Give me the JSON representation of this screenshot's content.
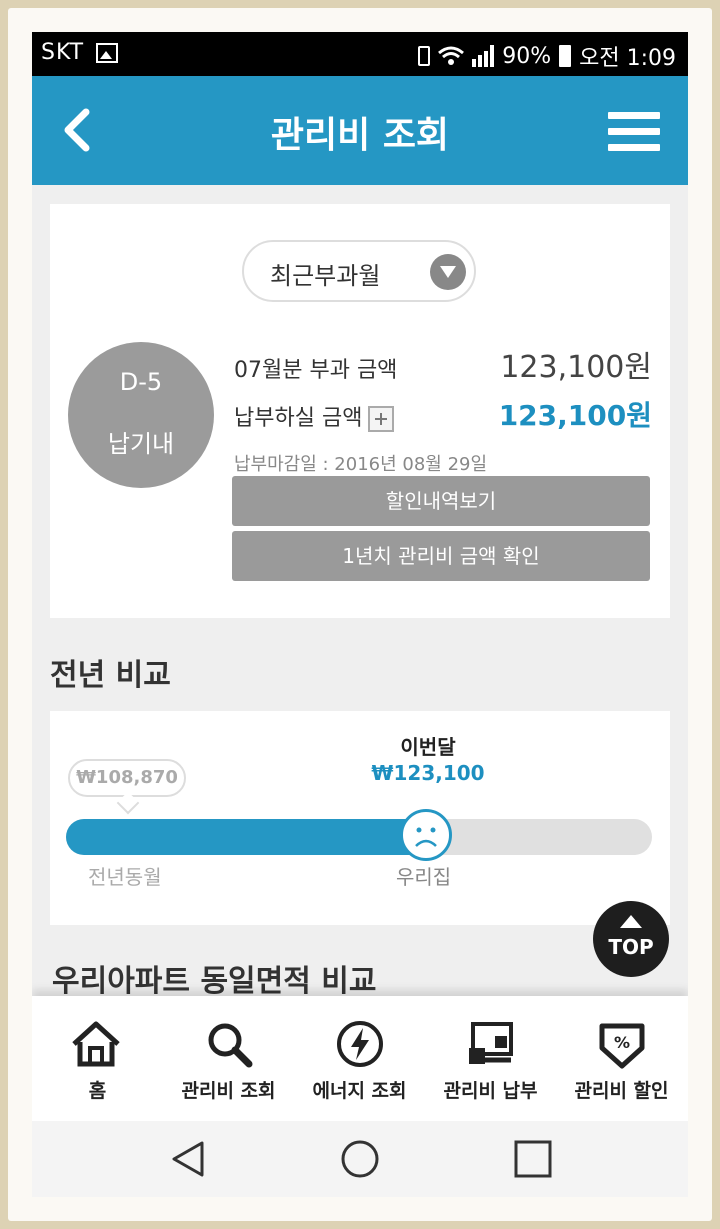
{
  "status_bar": {
    "carrier": "SKT",
    "battery": "90%",
    "time": "오전 1:09"
  },
  "header": {
    "title": "관리비 조회"
  },
  "bill": {
    "period_select": "최근부과월",
    "dday": "D-5",
    "dday_status": "납기내",
    "charged_label": "07월분 부과 금액",
    "charged_amount": "123,100원",
    "pay_label": "납부하실 금액",
    "pay_amount": "123,100원",
    "due_date": "납부마감일 : 2016년 08월 29일",
    "discount_button": "할인내역보기",
    "yearly_button": "1년치 관리비 금액 확인"
  },
  "comparison": {
    "section_title": "전년 비교",
    "this_month_label": "이번달",
    "this_month_amount": "₩123,100",
    "last_year_amount": "₩108,870",
    "last_year_label": "전년동월",
    "mine_label": "우리집",
    "progress": 0.6
  },
  "next_section_title": "우리아파트 동일면적 비교",
  "top_button": "TOP",
  "bottom_nav": [
    {
      "label": "홈",
      "icon": "home-icon"
    },
    {
      "label": "관리비 조회",
      "icon": "search-icon"
    },
    {
      "label": "에너지 조회",
      "icon": "energy-icon"
    },
    {
      "label": "관리비 납부",
      "icon": "payment-icon"
    },
    {
      "label": "관리비 할인",
      "icon": "discount-icon"
    }
  ],
  "colors": {
    "accent": "#2597c4",
    "amount_blue": "#1d8fc0",
    "gray_button": "#9a9a9a"
  }
}
